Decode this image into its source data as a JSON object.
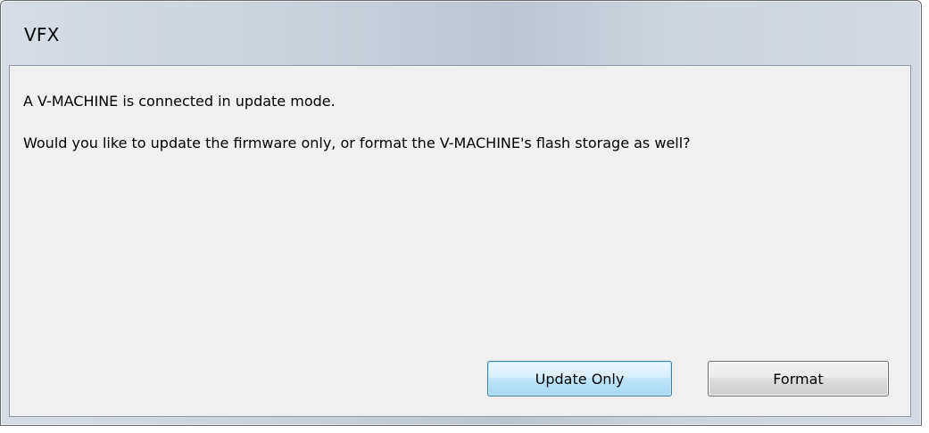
{
  "window": {
    "title": "VFX"
  },
  "dialog": {
    "message_line1": "A V-MACHINE is connected in update mode.",
    "message_line2": "Would you like to update the firmware only, or format the V-MACHINE's flash storage as well?"
  },
  "buttons": {
    "update_only_label": "Update Only",
    "format_label": "Format"
  },
  "colors": {
    "client_background": "#f0f0f0",
    "default_button_border": "#3c7fb1",
    "button_border": "#707070"
  }
}
